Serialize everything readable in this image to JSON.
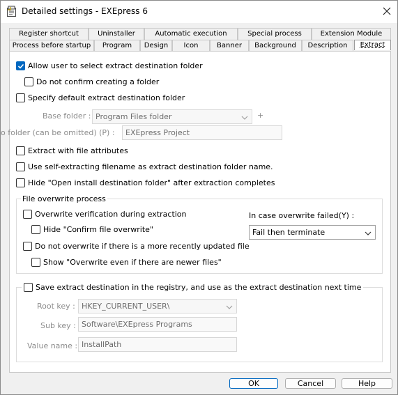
{
  "window": {
    "title": "Detailed settings - EXEpress 6",
    "app_icon": "settings-app-icon",
    "close_icon": "close-icon"
  },
  "tabs": {
    "row1": [
      "Register shortcut",
      "Uninstaller",
      "Automatic execution",
      "Special process",
      "Extension Module"
    ],
    "row2": [
      "Process before startup",
      "Program",
      "Design",
      "Icon",
      "Banner",
      "Background",
      "Description",
      "Extract"
    ],
    "active": "Extract"
  },
  "extract": {
    "allow_select_folder": {
      "label": "Allow user to select extract destination folder",
      "checked": true
    },
    "no_confirm_create": {
      "label": "Do not confirm creating a folder",
      "checked": false
    },
    "specify_default_folder": {
      "label": "Specify default extract destination folder",
      "checked": false
    },
    "base_folder": {
      "label": "Base folder :",
      "value": "Program Files folder",
      "plus": "+"
    },
    "subfolder": {
      "label": "o folder (can be omitted) (P) :",
      "value": "EXEpress Project"
    },
    "with_attributes": {
      "label": "Extract with file attributes",
      "checked": false
    },
    "use_sfx_filename": {
      "label": "Use self-extracting filename as extract destination folder name.",
      "checked": false
    },
    "hide_open_folder": {
      "label": "Hide \"Open install destination folder\" after extraction completes",
      "checked": false
    }
  },
  "overwrite": {
    "group_title": "File overwrite process",
    "verify": {
      "label": "Overwrite verification during extraction",
      "checked": false
    },
    "hide_confirm": {
      "label": "Hide \"Confirm file overwrite\"",
      "checked": false
    },
    "no_overwrite_newer": {
      "label": "Do not overwrite if there is a more recently updated file",
      "checked": false
    },
    "show_even_newer": {
      "label": "Show \"Overwrite even if there are newer files\"",
      "checked": false
    },
    "failed_label": "In case overwrite failed(Y) :",
    "failed_value": "Fail then terminate"
  },
  "registry": {
    "save": {
      "label": "Save extract destination in the registry, and use as the extract destination next time",
      "checked": false
    },
    "root_key": {
      "label": "Root key :",
      "value": "HKEY_CURRENT_USER\\"
    },
    "sub_key": {
      "label": "Sub key :",
      "value": "Software\\EXEpress Programs"
    },
    "value_name": {
      "label": "Value name :",
      "value": "InstallPath"
    }
  },
  "buttons": {
    "ok": "OK",
    "cancel": "Cancel",
    "help": "Help"
  },
  "colors": {
    "accent": "#0067c0",
    "panel": "#ffffff",
    "window_bg": "#f0f0f0"
  }
}
